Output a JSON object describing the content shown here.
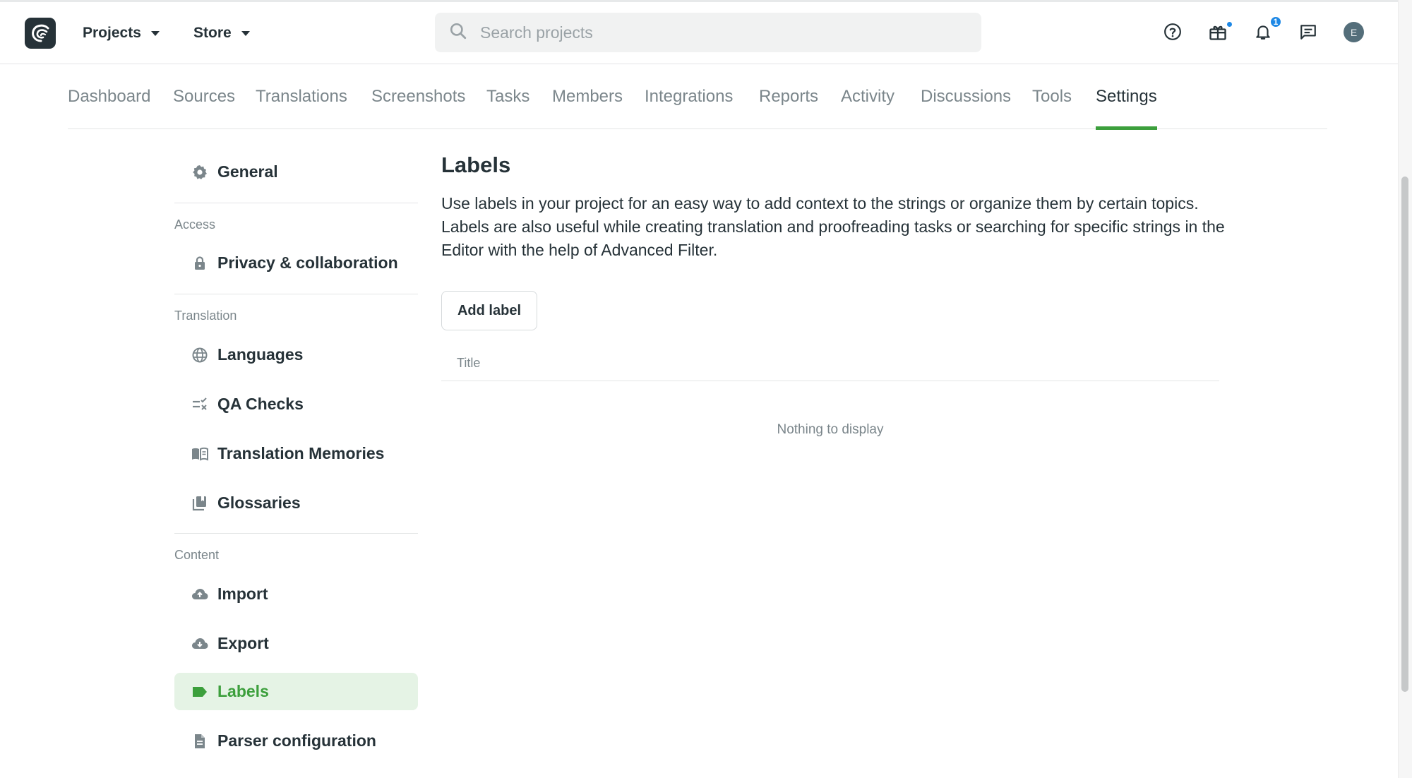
{
  "header": {
    "projects_label": "Projects",
    "store_label": "Store",
    "search_placeholder": "Search projects",
    "notification_count": "1",
    "avatar_initial": "E"
  },
  "tabs": [
    {
      "label": "Dashboard"
    },
    {
      "label": "Sources"
    },
    {
      "label": "Translations"
    },
    {
      "label": "Screenshots"
    },
    {
      "label": "Tasks"
    },
    {
      "label": "Members"
    },
    {
      "label": "Integrations"
    },
    {
      "label": "Reports"
    },
    {
      "label": "Activity"
    },
    {
      "label": "Discussions"
    },
    {
      "label": "Tools"
    },
    {
      "label": "Settings"
    }
  ],
  "active_tab": "Settings",
  "sidebar": {
    "general": "General",
    "access_heading": "Access",
    "privacy": "Privacy & collaboration",
    "translation_heading": "Translation",
    "languages": "Languages",
    "qa_checks": "QA Checks",
    "translation_memories": "Translation Memories",
    "glossaries": "Glossaries",
    "content_heading": "Content",
    "import": "Import",
    "export": "Export",
    "labels": "Labels",
    "parser_configuration": "Parser configuration"
  },
  "main": {
    "title": "Labels",
    "description": "Use labels in your project for an easy way to add context to the strings or organize them by certain topics. Labels are also useful while creating translation and proofreading tasks or searching for specific strings in the Editor with the help of Advanced Filter.",
    "add_label_button": "Add label",
    "table_header_title": "Title",
    "empty_message": "Nothing to display"
  },
  "colors": {
    "accent": "#3c9f3c",
    "text": "#263238",
    "muted": "#7b868b",
    "badge": "#1e88e5"
  },
  "icons": {
    "logo": "crowdin-logo-icon",
    "search": "search-icon",
    "help": "help-icon",
    "store": "gift-icon",
    "notifications": "bell-icon",
    "messages": "chat-icon"
  }
}
